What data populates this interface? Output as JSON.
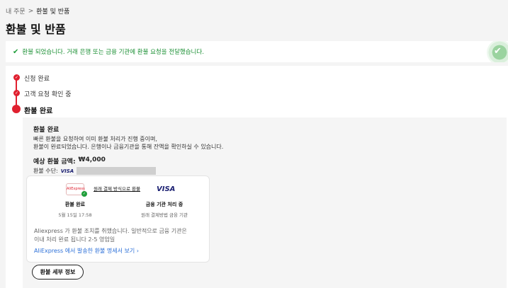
{
  "breadcrumb": {
    "parent": "내 주문",
    "separator": ">",
    "current": "환불 및 반품"
  },
  "page": {
    "title": "환불 및 반품"
  },
  "banner": {
    "check_glyph": "✔",
    "message": "환불 되었습니다. 거래 은행 또는 금융 기관에 환불 요청을 전달했습니다.",
    "deco_glyph": "✔",
    "color": "#1a8f33"
  },
  "timeline": {
    "check_glyph": "✓",
    "steps": [
      {
        "label": "신청 완료",
        "state": "done"
      },
      {
        "label": "고객 요청 확인 중",
        "state": "done"
      },
      {
        "label": "환불 완료",
        "state": "current"
      }
    ],
    "accent": "#e0202f"
  },
  "detail": {
    "title": "환불 완료",
    "desc_line1": "빠른 환불을 요청하여 이미 환불 처리가 진행 중이며,",
    "desc_line2": "환불이 완료되었습니다. 은행이나 금융기관을 통해 잔액을 확인하실 수 있습니다.",
    "amount_label": "예상 환불 금액:",
    "amount_value": "₩4,000",
    "method_label": "환불 수단:",
    "method_brand": "VISA"
  },
  "card": {
    "ae_logo": "AliExpress",
    "ae_check": "✓",
    "link_text": "원래 결제 방식으로 환불",
    "visa": "VISA",
    "left_title": "환불 완료",
    "left_date": "5월 15일 17:58",
    "right_title": "금융 기관 처리 중",
    "right_sub": "원래 결제방법 금융 기관",
    "note_line1": "Aliexpress 가 환불 조치를 취했습니다. 일반적으로 금융 기관은",
    "note_line2": "이내 처리 완료 됩니다 2-5 영업일",
    "statement_link": "AliExpress 에서 발송한 환불 명세서 보기 ›"
  },
  "buttons": {
    "refund_details": "환불 세부 정보"
  }
}
